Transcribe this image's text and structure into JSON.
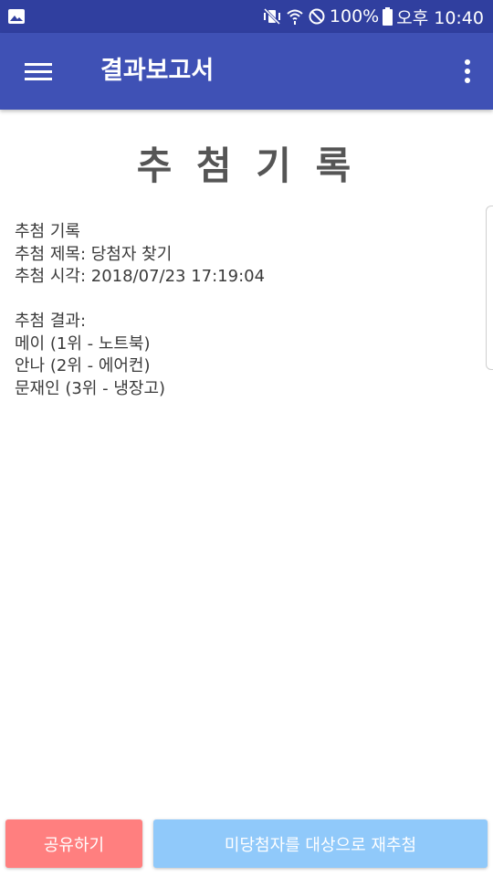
{
  "status_bar": {
    "battery": "100%",
    "time": "오후 10:40",
    "icons": [
      "gallery-icon",
      "mute-vibrate-icon",
      "wifi-icon",
      "block-icon",
      "battery-icon"
    ]
  },
  "app_bar": {
    "title": "결과보고서",
    "icons": [
      "menu-icon",
      "more-vert-icon"
    ]
  },
  "content": {
    "title": "추 첨 기 록",
    "lines": [
      "추첨 기록",
      "추첨 제목: 당첨자 찾기",
      "추첨 시각: 2018/07/23 17:19:04",
      "",
      "추첨 결과:",
      "메이 (1위 - 노트북)",
      "안나 (2위 - 에어컨)",
      "문재인 (3위 - 냉장고)"
    ]
  },
  "buttons": {
    "share": "공유하기",
    "redraw": "미당첨자를 대상으로 재추첨"
  },
  "colors": {
    "status_bar": "#303f9f",
    "app_bar": "#3f51b5",
    "share_button": "#ff7f7f",
    "redraw_button": "#90c9fa",
    "title_text": "#555555"
  }
}
